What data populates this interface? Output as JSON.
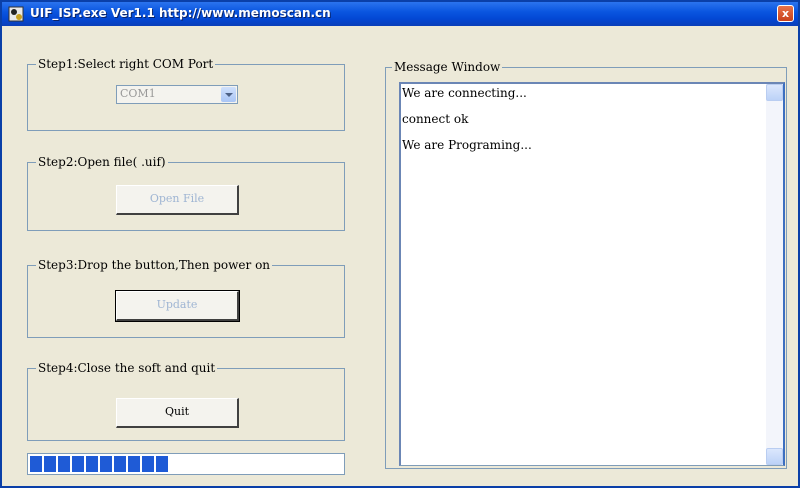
{
  "window": {
    "title": "UIF_ISP.exe  Ver1.1  http://www.memoscan.cn",
    "close_label": "x"
  },
  "step1": {
    "label": "Step1:Select right COM Port",
    "com_port": {
      "value": "COM1",
      "enabled": false
    }
  },
  "step2": {
    "label": "Step2:Open file( .uif)",
    "open_button": "Open File"
  },
  "step3": {
    "label": "Step3:Drop the button,Then power on",
    "update_button": "Update"
  },
  "step4": {
    "label": "Step4:Close the soft and quit",
    "quit_button": "Quit"
  },
  "progress": {
    "segments_filled": 10,
    "color": "#1f5bd6"
  },
  "message_window": {
    "label": "Message Window",
    "messages": [
      "We are connecting...",
      "connect ok",
      "We are Programing..."
    ]
  },
  "colors": {
    "titlebar": "#0a56e0",
    "face": "#ece9d8"
  },
  "icons": {
    "app": "app-icon",
    "close": "close-icon"
  }
}
